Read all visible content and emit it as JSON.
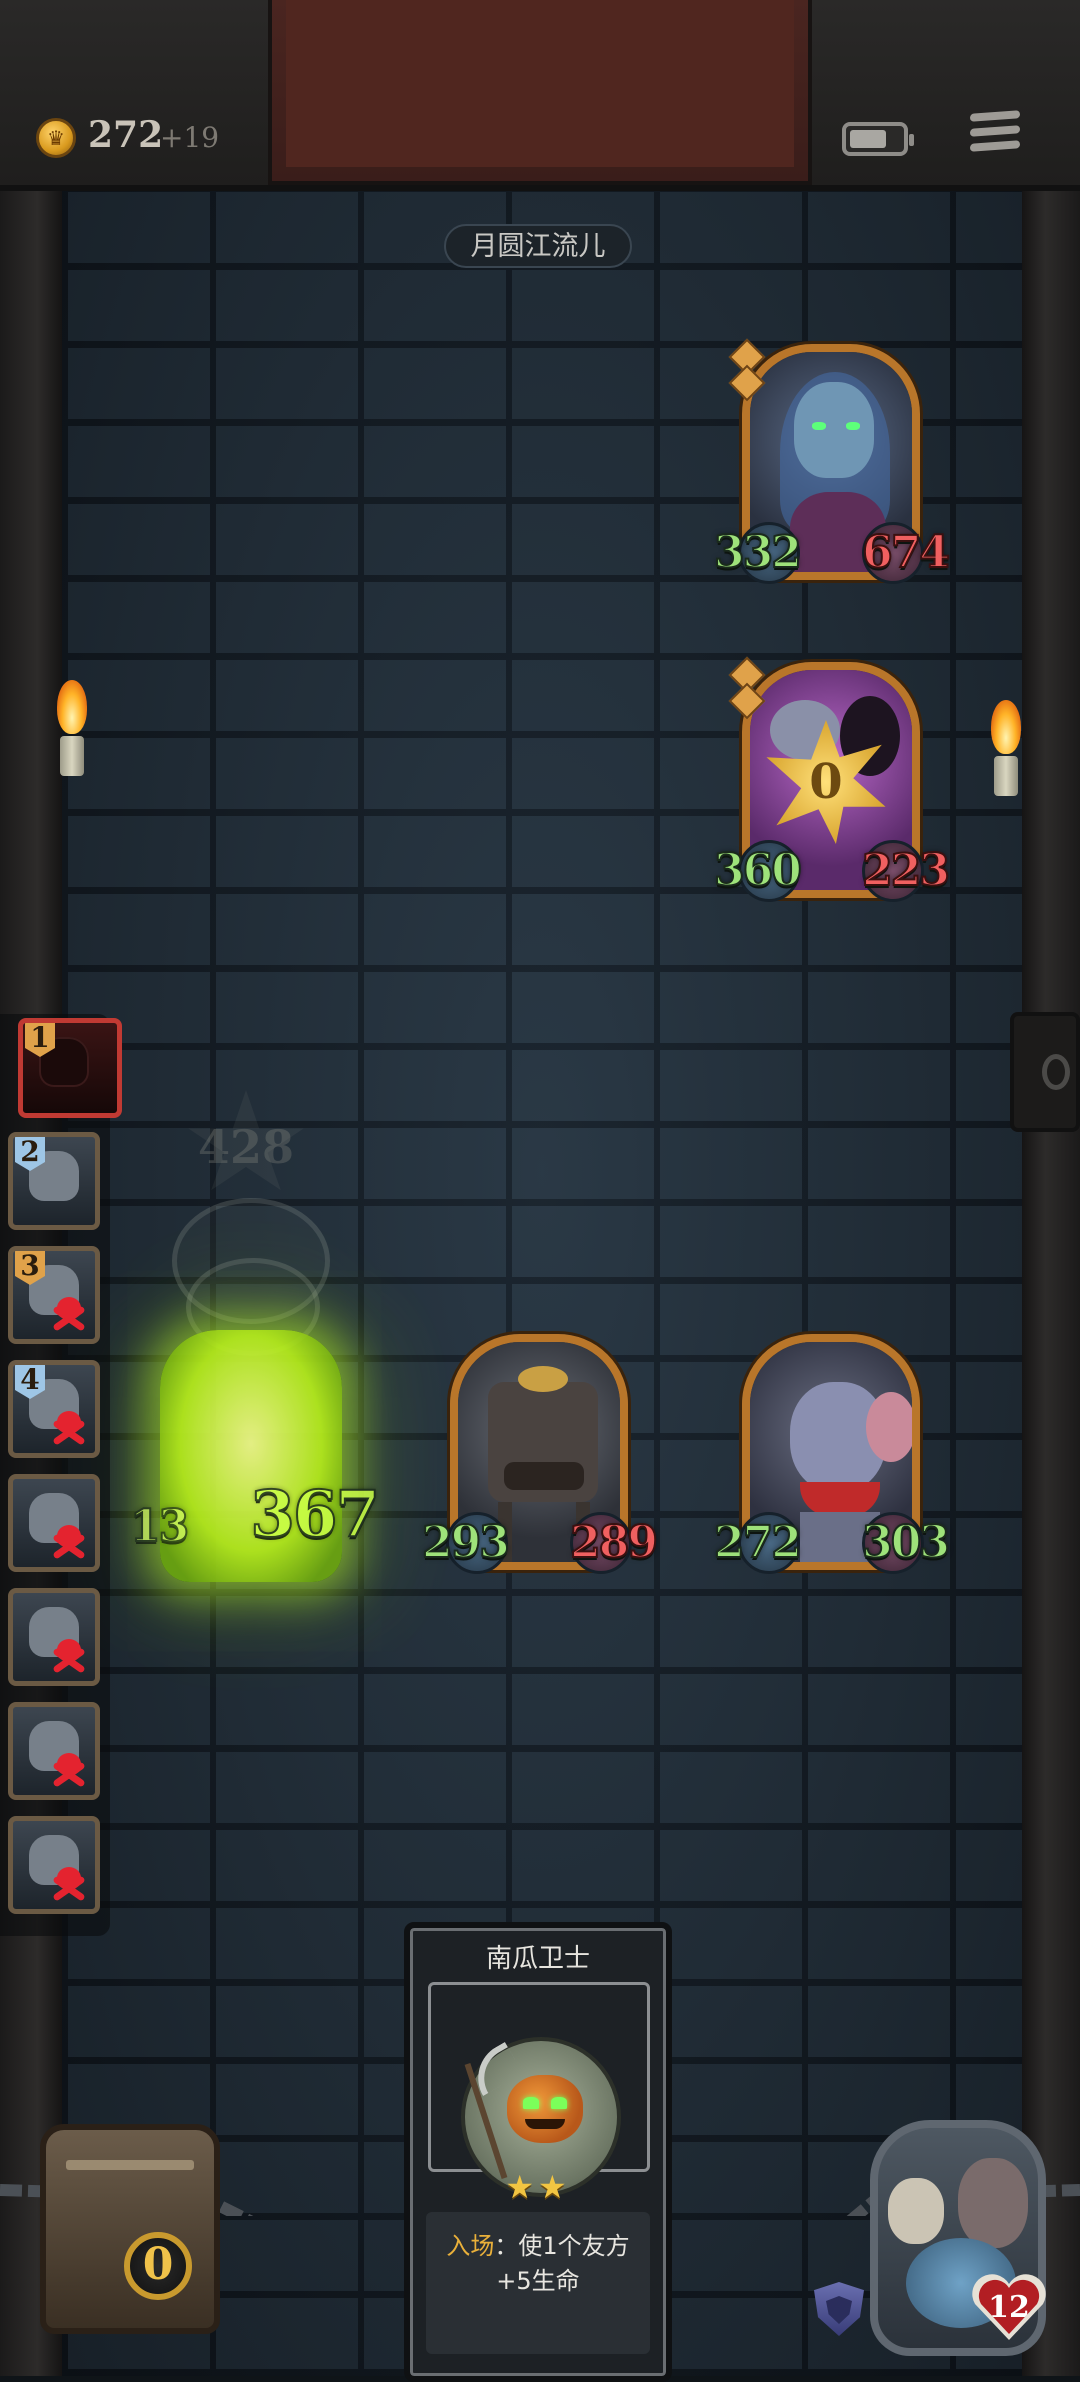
{
  "hud": {
    "gold": "272",
    "gold_income": "+19"
  },
  "location_label": "月圆江流儿",
  "enemy_units": [
    {
      "attack": "332",
      "health": "674",
      "health_color": "#f06060"
    },
    {
      "attack": "360",
      "health": "223",
      "health_color": "#f06060",
      "shield_value": "0"
    }
  ],
  "player_units": [
    {
      "attack": "293",
      "health": "289",
      "health_color": "#f06060"
    },
    {
      "attack": "272",
      "health": "303",
      "health_color": "#9ee27a"
    }
  ],
  "attacker": {
    "attack": "13",
    "health": "367",
    "ghost_value": "428"
  },
  "roster": [
    {
      "num": "1",
      "num_color": "#e0a24a",
      "state": "active"
    },
    {
      "num": "2",
      "num_color": "#9ec6e6",
      "state": "alive"
    },
    {
      "num": "3",
      "num_color": "#e0a24a",
      "state": "dead"
    },
    {
      "num": "4",
      "num_color": "#9ec6e6",
      "state": "dead"
    },
    {
      "num": "",
      "state": "dead"
    },
    {
      "num": "",
      "state": "dead"
    },
    {
      "num": "",
      "state": "dead"
    },
    {
      "num": "",
      "state": "dead"
    }
  ],
  "card": {
    "name": "南瓜卫士",
    "stars": "★★",
    "desc_label": "入场",
    "desc_text": "：使1个友方",
    "desc_line2": "+5生命"
  },
  "chest_count": "0",
  "hero": {
    "health": "12"
  },
  "colors": {
    "gold_accent": "#d99a1e",
    "attack_green": "#9ee27a",
    "health_red": "#f06060",
    "attacker_glow": "#b8f01c"
  }
}
